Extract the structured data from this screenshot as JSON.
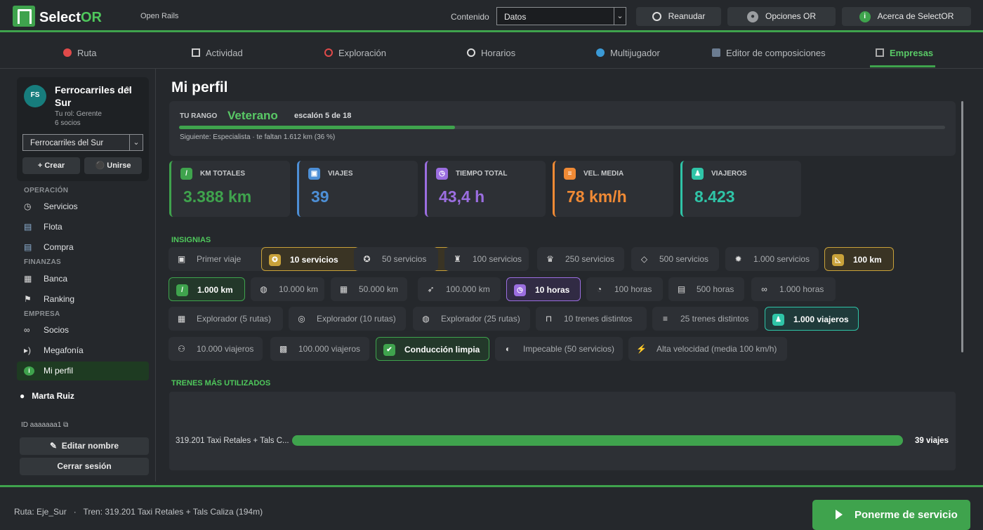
{
  "app": {
    "brand_1": "Select",
    "brand_2": "OR",
    "subtitle": "Open Rails"
  },
  "toolbar": {
    "content_label": "Contenido",
    "content_value": "Datos",
    "resume": "Reanudar",
    "options": "Opciones OR",
    "about": "Acerca de SelectOR"
  },
  "tabs": [
    {
      "label": "Ruta"
    },
    {
      "label": "Actividad"
    },
    {
      "label": "Exploración"
    },
    {
      "label": "Horarios"
    },
    {
      "label": "Multijugador"
    },
    {
      "label": "Editor de composiciones"
    },
    {
      "label": "Empresas"
    }
  ],
  "company": {
    "initials": "FS",
    "name": "Ferrocarriles del Sur",
    "role": "Tu rol: Gerente",
    "members": "6 socios",
    "selected": "Ferrocarriles del Sur",
    "create": "+ Crear",
    "join": "Unirse"
  },
  "sidebar": {
    "sections": {
      "operation": "OPERACIÓN",
      "finance": "FINANZAS",
      "company": "EMPRESA"
    },
    "items": [
      {
        "label": "Servicios"
      },
      {
        "label": "Flota"
      },
      {
        "label": "Compra"
      },
      {
        "label": "Banca"
      },
      {
        "label": "Ranking"
      },
      {
        "label": "Socios"
      },
      {
        "label": "Megafonía"
      },
      {
        "label": "Mi perfil"
      }
    ],
    "user": "Marta Ruiz",
    "user_id": "ID aaaaaaa1",
    "edit_name": "Editar nombre",
    "logout": "Cerrar sesión"
  },
  "profile": {
    "title": "Mi perfil",
    "rank_label": "TU RANGO",
    "rank": "Veterano",
    "rank_step": "escalón 5 de 18",
    "rank_progress": 0.36,
    "rank_next": "Siguiente: Especialista  ·  te faltan 1.612 km  (36 %)"
  },
  "stats": [
    {
      "label": "KM TOTALES",
      "value": "3.388 km",
      "color": "#3fa34d"
    },
    {
      "label": "VIAJES",
      "value": "39",
      "color": "#4d8fd6"
    },
    {
      "label": "TIEMPO TOTAL",
      "value": "43,4 h",
      "color": "#9b6ee0"
    },
    {
      "label": "VEL. MEDIA",
      "value": "78 km/h",
      "color": "#f08a35"
    },
    {
      "label": "VIAJEROS",
      "value": "8.423",
      "color": "#2fc4a7"
    }
  ],
  "badges_title": "INSIGNIAS",
  "badges": [
    {
      "label": "Primer viaje",
      "icon": "passenger-icon"
    },
    {
      "label": "10 servicios",
      "icon": "medal-icon"
    },
    {
      "label": "50 servicios",
      "icon": "medal-icon"
    },
    {
      "label": "100 servicios",
      "icon": "trophy-icon"
    },
    {
      "label": "250 servicios",
      "icon": "crown-icon"
    },
    {
      "label": "500 servicios",
      "icon": "diamond-icon"
    },
    {
      "label": "1.000 servicios",
      "icon": "star-icon"
    },
    {
      "label": "100 km",
      "icon": "ruler-icon"
    },
    {
      "label": "1.000 km",
      "icon": "rail-icon"
    },
    {
      "label": "10.000 km",
      "icon": "globe-icon"
    },
    {
      "label": "50.000 km",
      "icon": "map-icon"
    },
    {
      "label": "100.000 km",
      "icon": "rocket-icon"
    },
    {
      "label": "10 horas",
      "icon": "stopwatch-icon"
    },
    {
      "label": "100 horas",
      "icon": "clock-icon"
    },
    {
      "label": "500 horas",
      "icon": "calendar-icon"
    },
    {
      "label": "1.000 horas",
      "icon": "infinity-icon"
    },
    {
      "label": "Explorador (5 rutas)",
      "icon": "map-icon"
    },
    {
      "label": "Explorador (10 rutas)",
      "icon": "compass-icon"
    },
    {
      "label": "Explorador (25 rutas)",
      "icon": "globe-icon"
    },
    {
      "label": "10 trenes distintos",
      "icon": "train-icon"
    },
    {
      "label": "25 trenes distintos",
      "icon": "railway-icon"
    },
    {
      "label": "1.000 viajeros",
      "icon": "person-icon"
    },
    {
      "label": "10.000 viajeros",
      "icon": "people-icon"
    },
    {
      "label": "100.000 viajeros",
      "icon": "stadium-icon"
    },
    {
      "label": "Conducción limpia",
      "icon": "check-icon"
    },
    {
      "label": "Impecable (50 servicios)",
      "icon": "shield-icon"
    },
    {
      "label": "Alta velocidad (media 100 km/h)",
      "icon": "bolt-icon"
    }
  ],
  "trains_title": "TRENES MÁS UTILIZADOS",
  "trains": [
    {
      "name": "319.201 Taxi Retales + Tals C...",
      "count": "39 viajes",
      "share": 1.0
    }
  ],
  "footer": {
    "route": "Ruta: Eje_Sur   ·   Tren: 319.201 Taxi Retales + Tals Caliza (194m)",
    "cta": "Ponerme de servicio"
  }
}
